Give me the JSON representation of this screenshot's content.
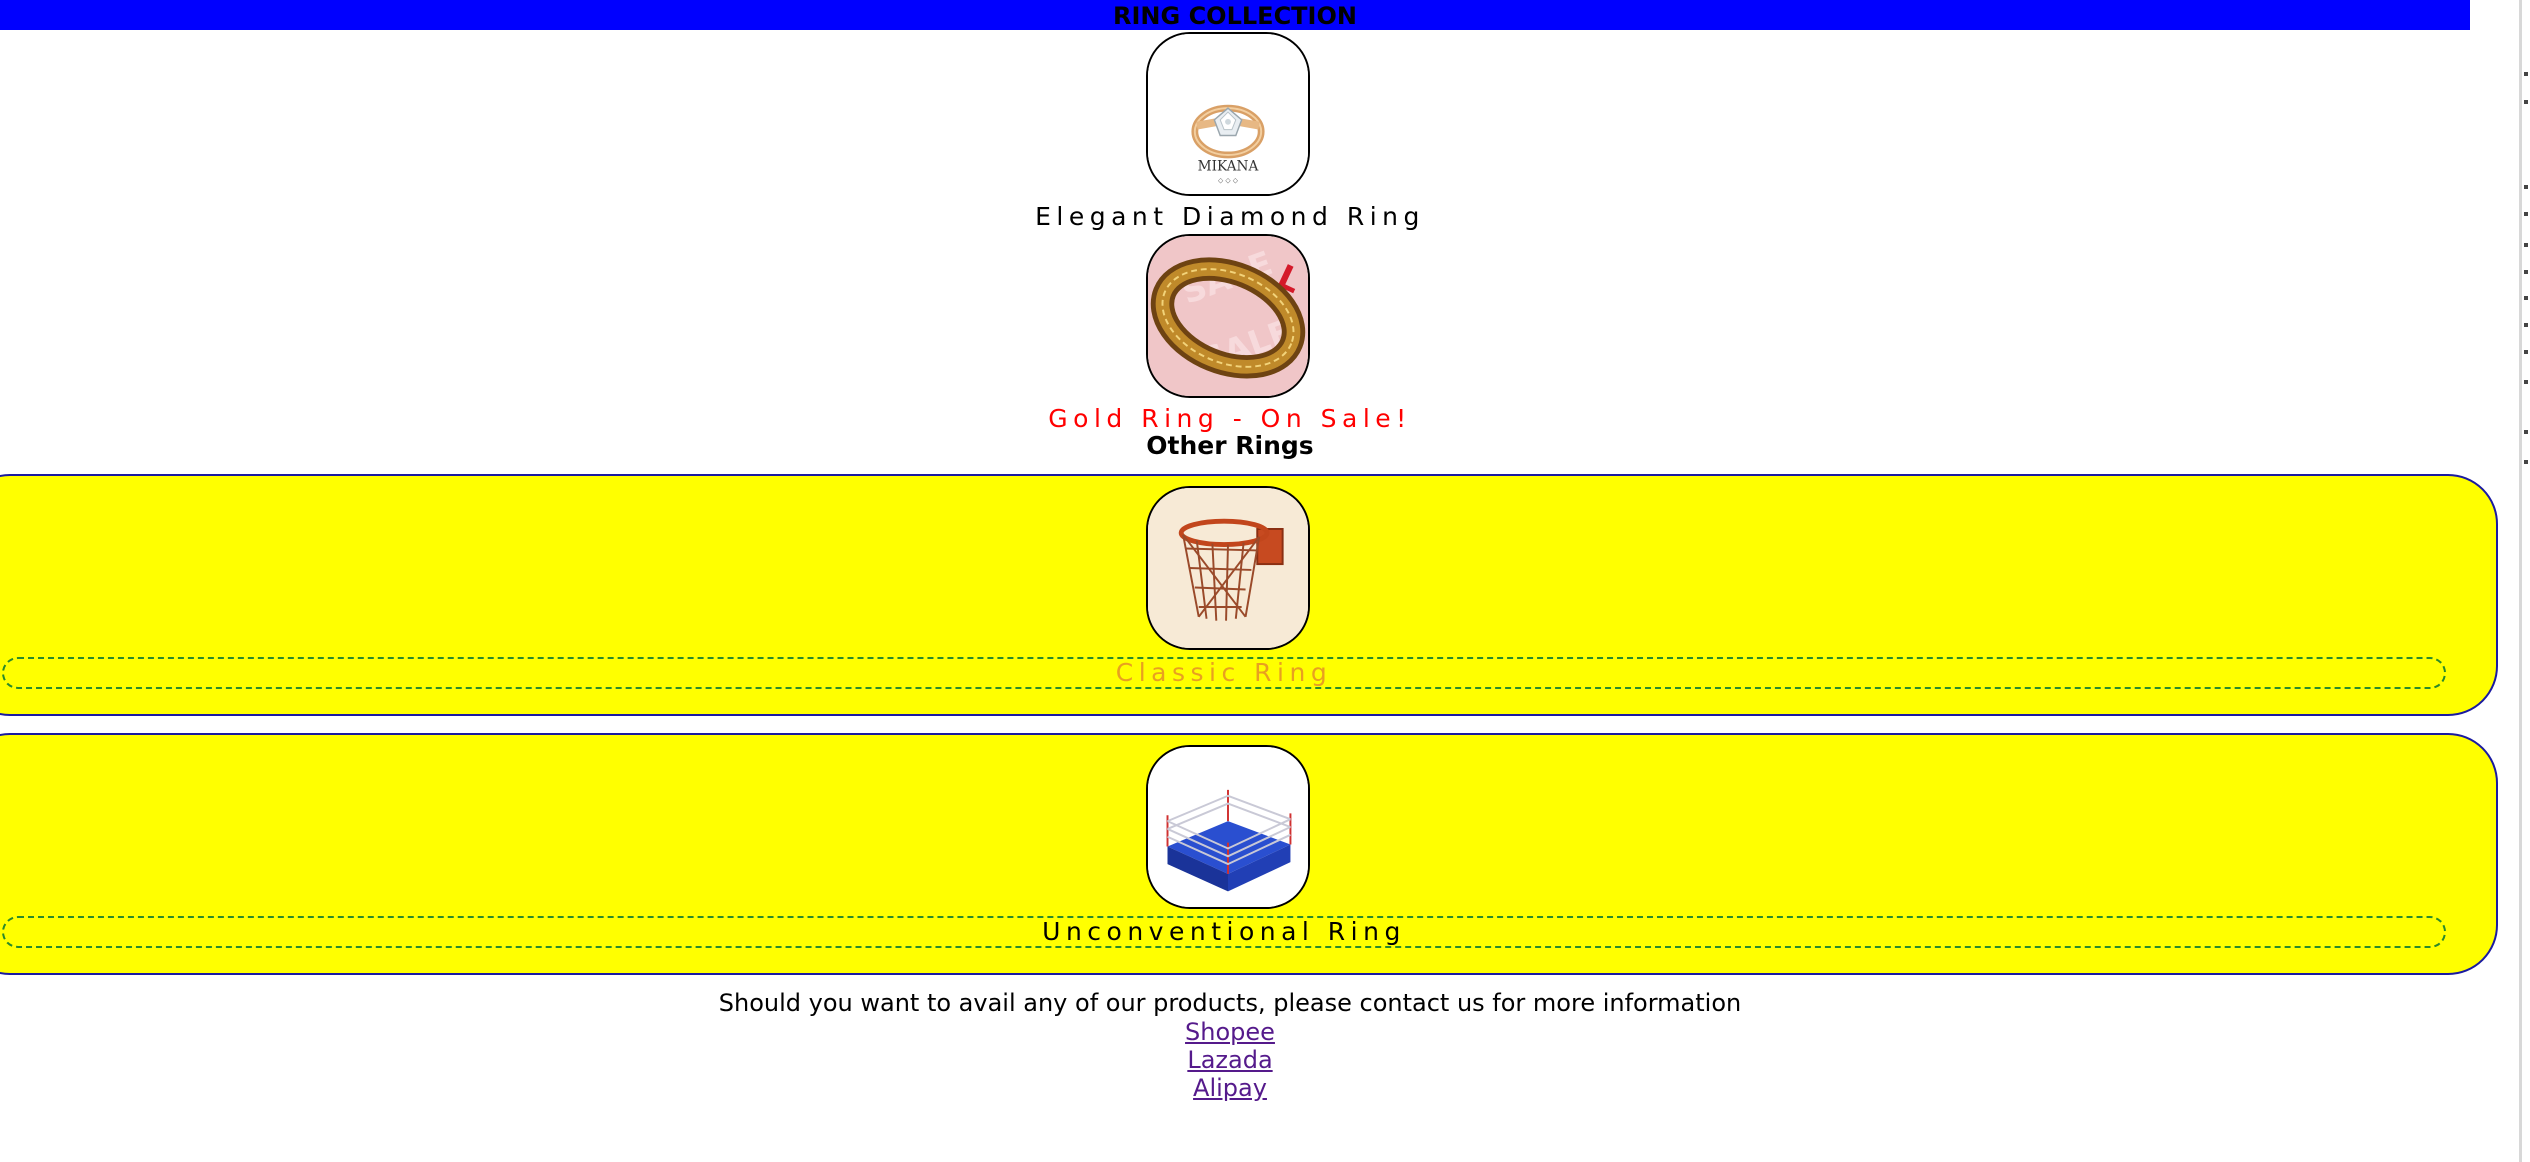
{
  "header": {
    "title": "RING COLLECTION"
  },
  "featured": [
    {
      "caption": "Elegant Diamond Ring",
      "caption_color": "#000000",
      "image_icon": "diamond-ring-image",
      "brand_text": "MIKANA"
    },
    {
      "caption": "Gold Ring - On Sale!",
      "caption_color": "#ff0000",
      "image_icon": "gold-ring-image"
    }
  ],
  "other_section": {
    "title": "Other Rings",
    "items": [
      {
        "caption": "Classic Ring",
        "caption_color": "#e8a020",
        "image_icon": "basketball-hoop-image"
      },
      {
        "caption": "Unconventional Ring",
        "caption_color": "#000000",
        "image_icon": "boxing-ring-image"
      }
    ]
  },
  "footer": {
    "contact_text": "Should you want to avail any of our products, please contact us for more information",
    "links": [
      "Shopee",
      "Lazada",
      "Alipay"
    ]
  },
  "colors": {
    "header_bg": "#0000ff",
    "panel_bg": "#ffff00",
    "panel_border": "#1a1aa0",
    "label_border": "#2a8a2a",
    "link": "#551a8b"
  }
}
